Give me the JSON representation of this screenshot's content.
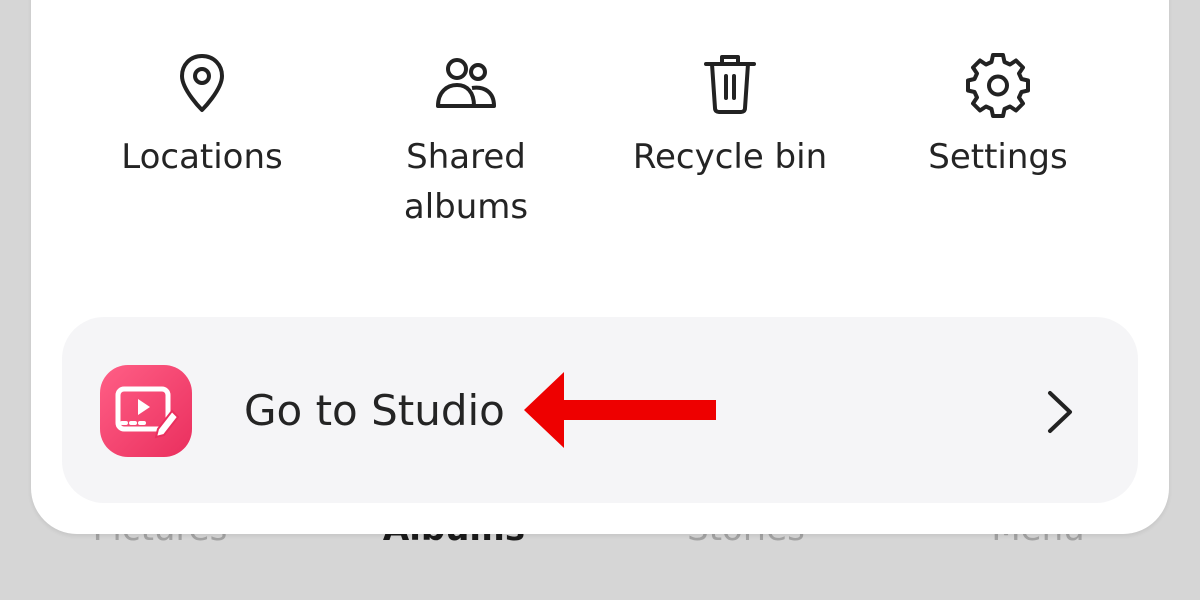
{
  "bottom_nav": {
    "tabs": [
      {
        "label": "Pictures",
        "active": false
      },
      {
        "label": "Albums",
        "active": true
      },
      {
        "label": "Stories",
        "active": false
      },
      {
        "label": "Menu",
        "active": false
      }
    ]
  },
  "menu_grid": {
    "items": [
      {
        "label": "Locations",
        "icon": "location-pin-icon"
      },
      {
        "label": "Shared albums",
        "icon": "people-icon"
      },
      {
        "label": "Recycle bin",
        "icon": "trash-icon"
      },
      {
        "label": "Settings",
        "icon": "gear-icon"
      }
    ]
  },
  "studio_row": {
    "label": "Go to Studio",
    "icon": "studio-app-icon",
    "chevron": "chevron-right-icon"
  },
  "annotation": {
    "icon": "red-arrow-icon",
    "color": "#ee0000"
  },
  "colors": {
    "studio_gradient_start": "#ff5f86",
    "studio_gradient_end": "#ea2f5e",
    "background": "#d6d6d6"
  }
}
